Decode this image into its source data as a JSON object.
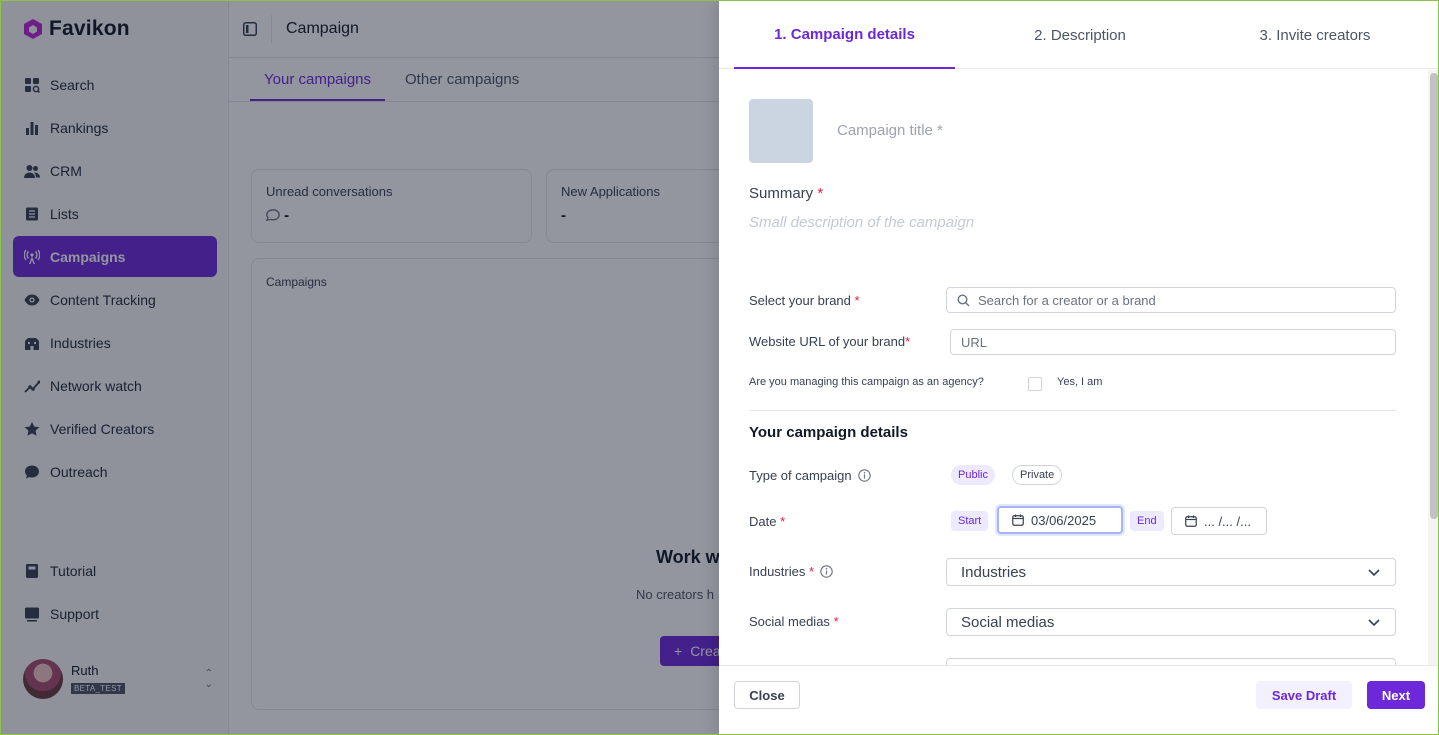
{
  "app": {
    "name": "Favikon"
  },
  "sidebar": {
    "items": [
      {
        "label": "Search",
        "icon": "search-icon"
      },
      {
        "label": "Rankings",
        "icon": "bar-chart-icon"
      },
      {
        "label": "CRM",
        "icon": "users-icon"
      },
      {
        "label": "Lists",
        "icon": "list-icon"
      },
      {
        "label": "Campaigns",
        "icon": "broadcast-icon",
        "active": true
      },
      {
        "label": "Content Tracking",
        "icon": "eye-icon"
      },
      {
        "label": "Industries",
        "icon": "building-icon"
      },
      {
        "label": "Network watch",
        "icon": "network-icon"
      },
      {
        "label": "Verified Creators",
        "icon": "star-icon"
      },
      {
        "label": "Outreach",
        "icon": "chat-icon"
      }
    ],
    "bottom_items": [
      {
        "label": "Tutorial",
        "icon": "book-icon"
      },
      {
        "label": "Support",
        "icon": "support-icon"
      }
    ],
    "user": {
      "name": "Ruth",
      "badge": "BETA_TEST"
    }
  },
  "header": {
    "title": "Campaign"
  },
  "tabs": [
    {
      "label": "Your campaigns",
      "active": true
    },
    {
      "label": "Other campaigns"
    }
  ],
  "stats": [
    {
      "label": "Unread conversations",
      "value": "-"
    },
    {
      "label": "New Applications",
      "value": "-"
    }
  ],
  "campaigns_card": {
    "label": "Campaigns",
    "empty_title": "Work w",
    "empty_desc": "No creators h",
    "create_label": "Crea"
  },
  "drawer": {
    "steps": [
      {
        "label": "1. Campaign details",
        "active": true
      },
      {
        "label": "2. Description"
      },
      {
        "label": "3. Invite creators"
      }
    ],
    "title_placeholder": "Campaign title *",
    "summary_label": "Summary",
    "summary_placeholder": "Small description of the campaign",
    "brand_label": "Select your brand",
    "brand_placeholder": "Search for a creator or a brand",
    "website_label": "Website URL of your brand",
    "website_placeholder": "URL",
    "agency_question": "Are you managing this campaign as an agency?",
    "agency_yes": "Yes, I am",
    "section_title": "Your campaign details",
    "type_label": "Type of campaign",
    "type_options": [
      "Public",
      "Private"
    ],
    "date_label": "Date",
    "date_start_tag": "Start",
    "date_start_value": "03/06/2025",
    "date_end_tag": "End",
    "date_end_value": "... /... /...",
    "industries_label": "Industries",
    "industries_value": "Industries",
    "social_label": "Social medias",
    "social_value": "Social medias",
    "footer": {
      "close": "Close",
      "save_draft": "Save Draft",
      "next": "Next"
    }
  },
  "colors": {
    "accent": "#6d28d9",
    "required": "#e11d48"
  }
}
